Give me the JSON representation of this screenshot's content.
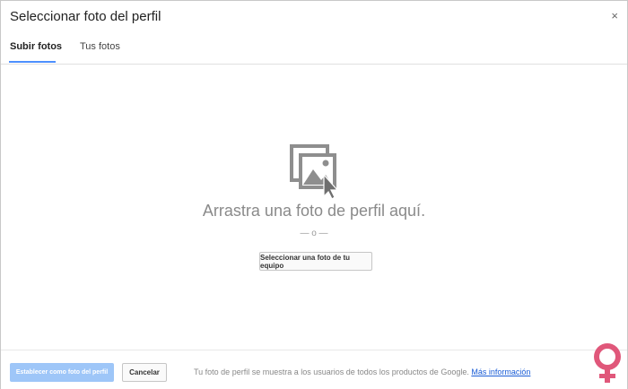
{
  "dialog": {
    "title": "Seleccionar foto del perfil",
    "close_label": "×"
  },
  "tabs": [
    {
      "label": "Subir fotos",
      "active": true
    },
    {
      "label": "Tus fotos",
      "active": false
    }
  ],
  "drop_zone": {
    "icon": "image-drop-icon",
    "text": "Arrastra una foto de perfil aquí.",
    "separator": "— o —",
    "upload_button": "Seleccionar una foto de tu equipo"
  },
  "footer": {
    "set_button": "Establecer como foto del perfil",
    "cancel_button": "Cancelar",
    "info_text": "Tu foto de perfil se muestra a los usuarios de todos los productos de Google.",
    "info_link": "Más información"
  },
  "colors": {
    "accent": "#4d90fe",
    "primary_disabled": "#9ec6f8",
    "link": "#1a5dd6",
    "watermark": "#e0577a"
  },
  "watermark_icon": "woman-symbol-logo"
}
